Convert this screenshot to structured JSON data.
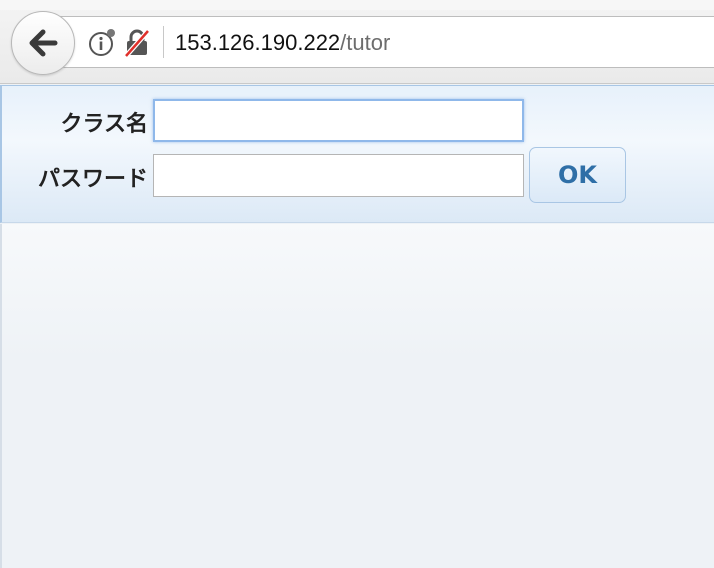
{
  "browser": {
    "url_host": "153.126.190.222",
    "url_path": "/tutor",
    "icons": {
      "back": "back-arrow-icon",
      "info": "info-icon",
      "insecure": "insecure-lock-icon"
    }
  },
  "login_form": {
    "class_label": "クラス名",
    "class_value": "",
    "password_label": "パスワード",
    "password_value": "",
    "ok_label": "OK"
  },
  "colors": {
    "ok_text": "#2f6fa7",
    "form_background": "#e7f1fb",
    "focus_border": "#8fb8ea"
  }
}
